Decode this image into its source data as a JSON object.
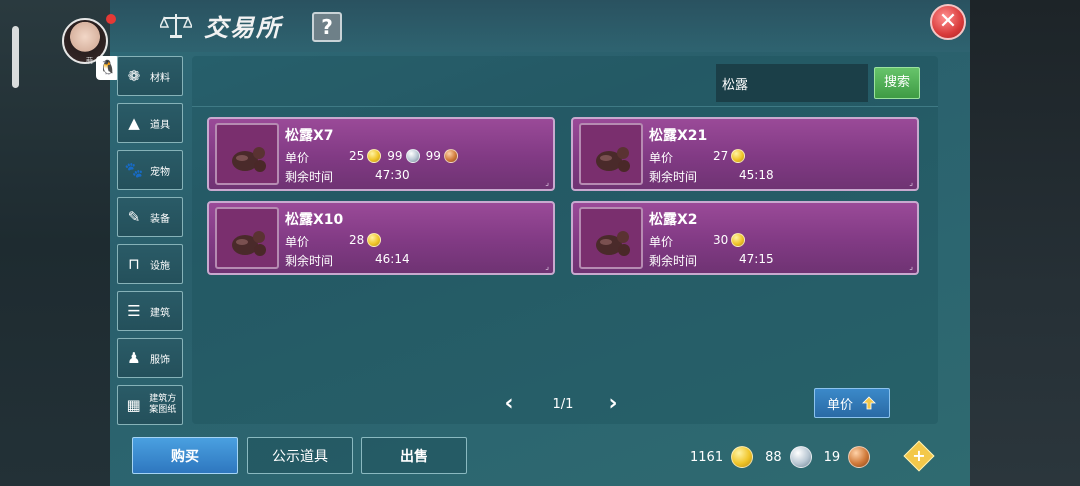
{
  "header": {
    "title": "交易所",
    "help_label": "?",
    "close_label": "✕"
  },
  "user": {
    "avatar_name": "萌",
    "qq_label": "🐧"
  },
  "sidebar": {
    "items": [
      {
        "label": "材料",
        "icon": "materials-icon",
        "glyph": "❁"
      },
      {
        "label": "道具",
        "icon": "props-icon",
        "glyph": "▲"
      },
      {
        "label": "宠物",
        "icon": "paw-icon",
        "glyph": "🐾"
      },
      {
        "label": "装备",
        "icon": "equipment-icon",
        "glyph": "✎"
      },
      {
        "label": "设施",
        "icon": "facility-icon",
        "glyph": "⊓"
      },
      {
        "label": "建筑",
        "icon": "building-icon",
        "glyph": "☰"
      },
      {
        "label": "服饰",
        "icon": "clothing-icon",
        "glyph": "♟"
      },
      {
        "label": "建筑方案图纸",
        "icon": "blueprint-icon",
        "glyph": "▦"
      }
    ]
  },
  "search": {
    "value": "松露",
    "button_label": "搜索"
  },
  "listings": [
    {
      "title": "松露X7",
      "price_label": "单价",
      "gold": "25",
      "silver": "99",
      "copper": "99",
      "time_label": "剩余时间",
      "time": "47:30"
    },
    {
      "title": "松露X21",
      "price_label": "单价",
      "gold": "27",
      "silver": "",
      "copper": "",
      "time_label": "剩余时间",
      "time": "45:18"
    },
    {
      "title": "松露X10",
      "price_label": "单价",
      "gold": "28",
      "silver": "",
      "copper": "",
      "time_label": "剩余时间",
      "time": "46:14"
    },
    {
      "title": "松露X2",
      "price_label": "单价",
      "gold": "30",
      "silver": "",
      "copper": "",
      "time_label": "剩余时间",
      "time": "47:15"
    }
  ],
  "pager": {
    "text": "1/1",
    "prev": "‹",
    "next": "›"
  },
  "sort": {
    "label": "单价"
  },
  "actions": {
    "buy": "购买",
    "show": "公示道具",
    "sell": "出售"
  },
  "wallet": {
    "gold": "1161",
    "silver": "88",
    "copper": "19",
    "plus": "+"
  },
  "colors": {
    "card": "#813a84",
    "panel": "#2c6670",
    "buy_button": "#2e77bf",
    "search_button": "#3e9b44"
  }
}
